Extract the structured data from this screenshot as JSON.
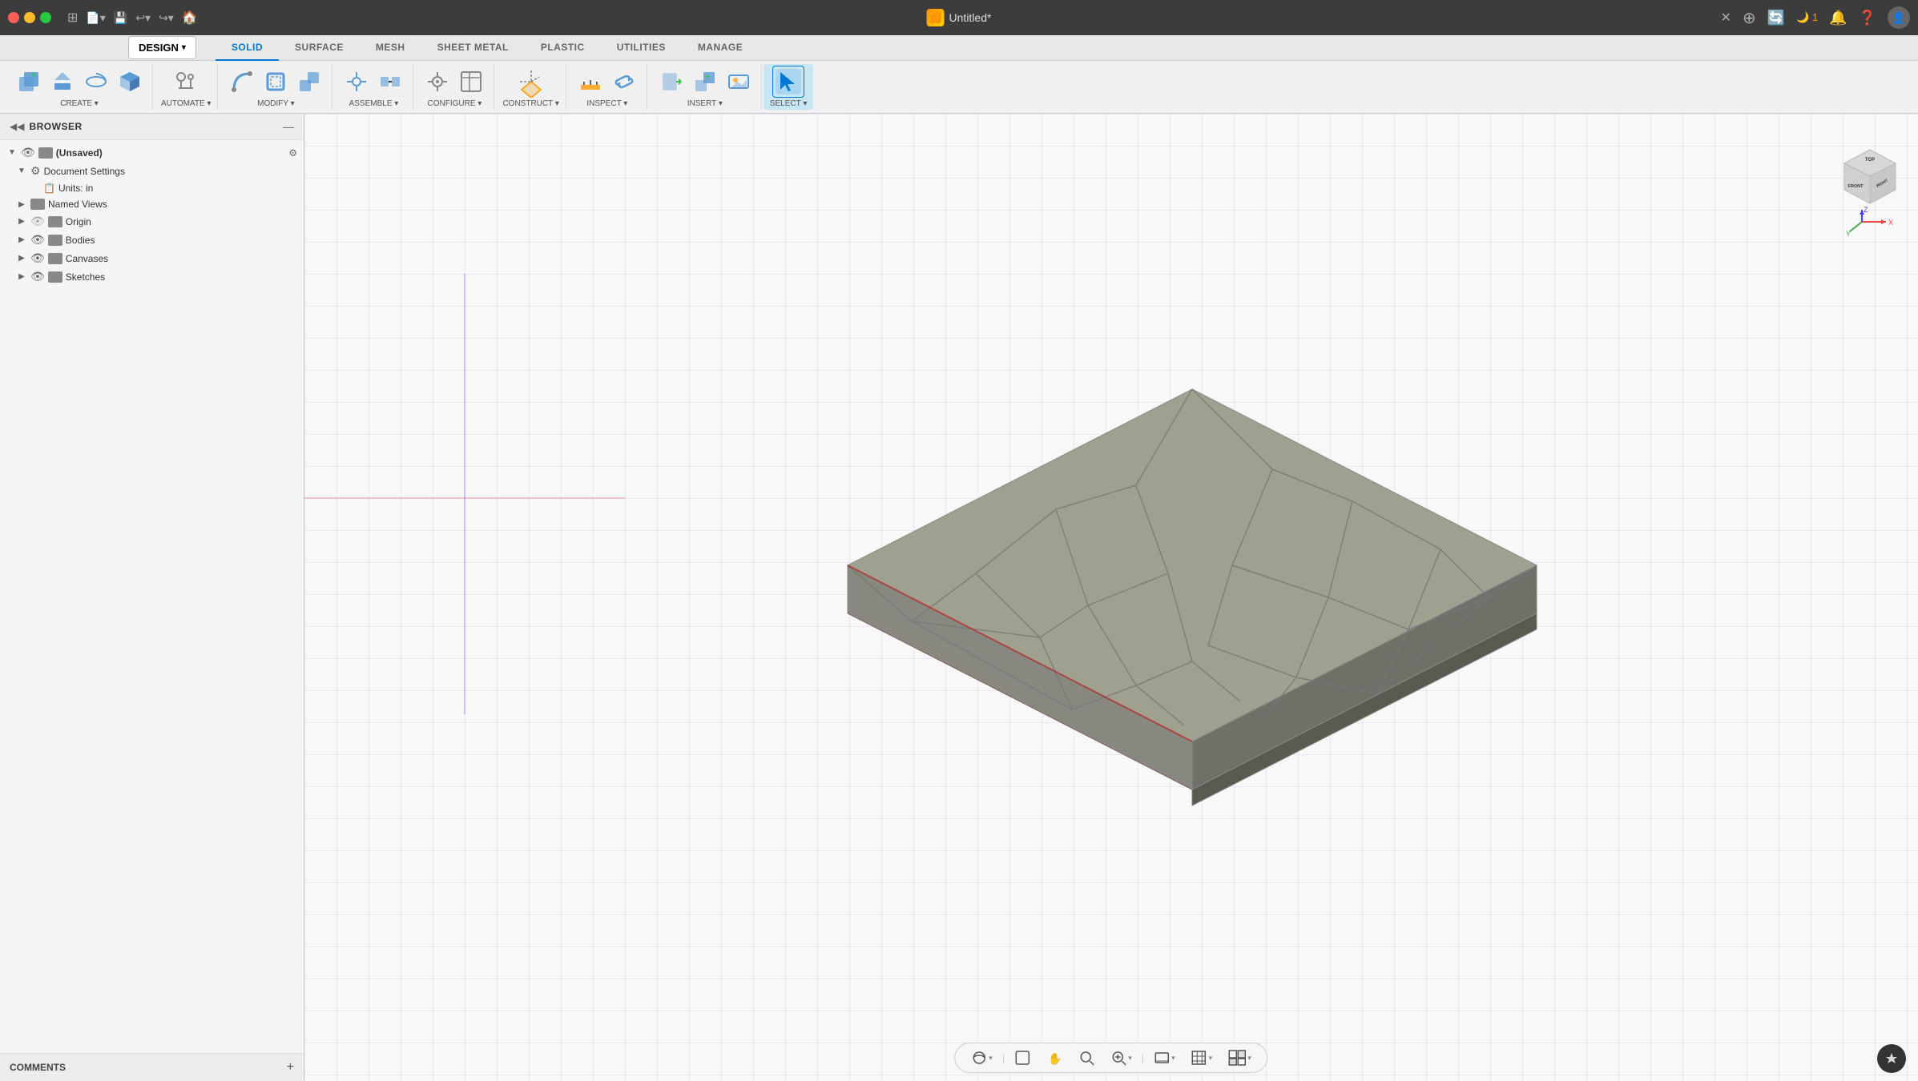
{
  "titleBar": {
    "title": "Untitled*",
    "appIcon": "🟧"
  },
  "tabs": [
    {
      "label": "SOLID",
      "active": true
    },
    {
      "label": "SURFACE",
      "active": false
    },
    {
      "label": "MESH",
      "active": false
    },
    {
      "label": "SHEET METAL",
      "active": false
    },
    {
      "label": "PLASTIC",
      "active": false
    },
    {
      "label": "UTILITIES",
      "active": false
    },
    {
      "label": "MANAGE",
      "active": false
    }
  ],
  "toolbar": {
    "designLabel": "DESIGN",
    "groups": [
      {
        "label": "CREATE ▾",
        "icons": [
          "new-component-icon",
          "extrude-icon",
          "revolve-icon",
          "box-icon"
        ]
      },
      {
        "label": "AUTOMATE ▾",
        "icons": [
          "automate-icon"
        ]
      },
      {
        "label": "MODIFY ▾",
        "icons": [
          "fillet-icon",
          "shell-icon",
          "combine-icon"
        ]
      },
      {
        "label": "ASSEMBLE ▾",
        "icons": [
          "joint-icon",
          "rigid-icon"
        ]
      },
      {
        "label": "CONFIGURE ▾",
        "icons": [
          "configure-icon",
          "table-icon"
        ]
      },
      {
        "label": "CONSTRUCT ▾",
        "icons": [
          "plane-icon"
        ]
      },
      {
        "label": "INSPECT ▾",
        "icons": [
          "measure-icon",
          "link-icon"
        ]
      },
      {
        "label": "INSERT ▾",
        "icons": [
          "insert-icon",
          "addcomponent-icon",
          "image-icon"
        ]
      },
      {
        "label": "SELECT ▾",
        "icons": [
          "select-icon"
        ]
      }
    ]
  },
  "browser": {
    "title": "BROWSER",
    "items": [
      {
        "label": "(Unsaved)",
        "level": 0,
        "hasArrow": true,
        "hasEye": true,
        "hasSettings": true,
        "expanded": true
      },
      {
        "label": "Document Settings",
        "level": 1,
        "hasArrow": true,
        "hasSettings": true,
        "expanded": true
      },
      {
        "label": "Units: in",
        "level": 2,
        "hasArrow": false,
        "hasSettings": false,
        "icon": "📄"
      },
      {
        "label": "Named Views",
        "level": 1,
        "hasArrow": true,
        "hasSettings": false
      },
      {
        "label": "Origin",
        "level": 1,
        "hasArrow": true,
        "hasEye": true,
        "hasFolder": true
      },
      {
        "label": "Bodies",
        "level": 1,
        "hasArrow": true,
        "hasEye": true,
        "hasFolder": true
      },
      {
        "label": "Canvases",
        "level": 1,
        "hasArrow": true,
        "hasEye": true,
        "hasFolder": true
      },
      {
        "label": "Sketches",
        "level": 1,
        "hasArrow": true,
        "hasEye": true,
        "hasFolder": true
      }
    ]
  },
  "comments": {
    "label": "COMMENTS",
    "addLabel": "+"
  },
  "bottomToolbar": {
    "tools": [
      {
        "name": "orbit",
        "icon": "⊕",
        "hasDropdown": true
      },
      {
        "name": "pan-view",
        "icon": "⊞",
        "hasDropdown": false
      },
      {
        "name": "pan",
        "icon": "✋",
        "hasDropdown": false
      },
      {
        "name": "zoom-fit",
        "icon": "🔍",
        "hasDropdown": false
      },
      {
        "name": "zoom",
        "icon": "⊕",
        "hasDropdown": true
      },
      {
        "name": "display-mode",
        "icon": "🖥",
        "hasDropdown": true
      },
      {
        "name": "grid",
        "icon": "⊞",
        "hasDropdown": true
      },
      {
        "name": "view-cube",
        "icon": "⊟",
        "hasDropdown": true
      }
    ]
  },
  "navCube": {
    "topLabel": "TOP",
    "frontLabel": "FRONT",
    "rightLabel": "RIGHT",
    "xColor": "#e44",
    "yColor": "#44e",
    "zColor": "#4a4"
  }
}
